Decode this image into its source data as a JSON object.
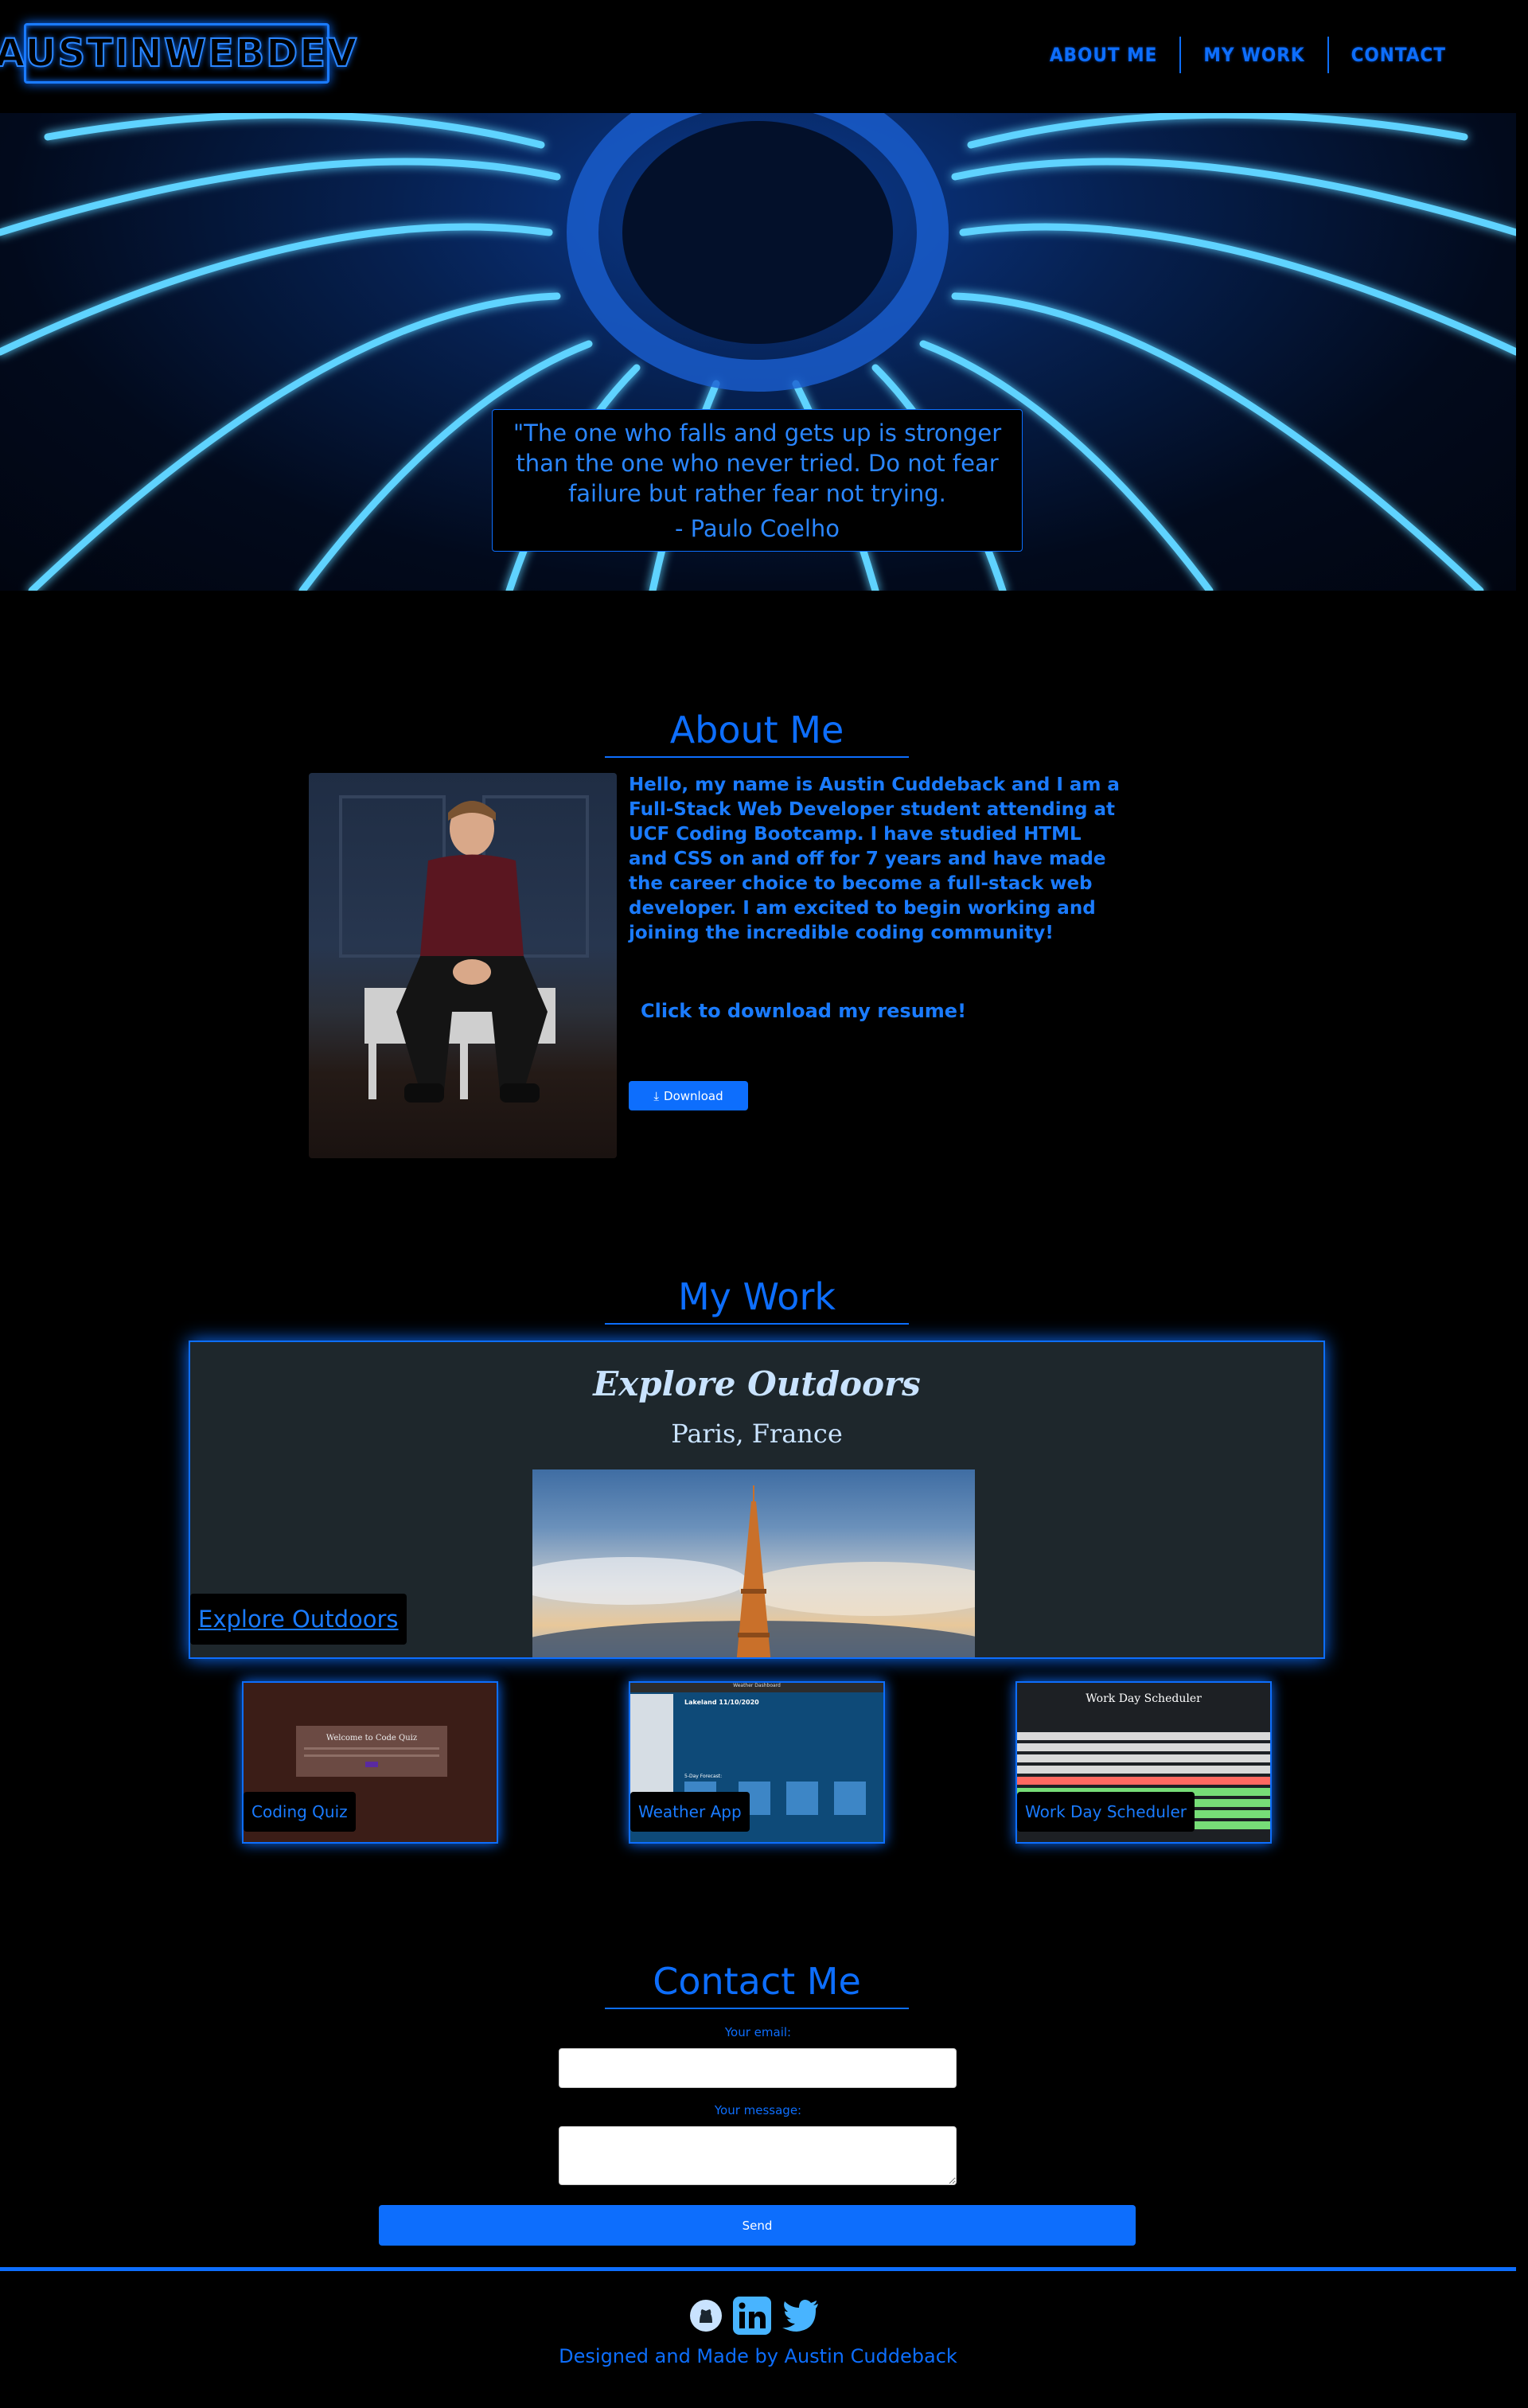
{
  "nav": {
    "logo": "AUSTINWEBDEV",
    "links": [
      "ABOUT ME",
      "MY WORK",
      "CONTACT"
    ]
  },
  "hero": {
    "quote": "\"The one who falls and gets up is stronger than the one who never tried. Do not fear failure but rather fear not trying.",
    "author": "- Paulo Coelho"
  },
  "about": {
    "title": "About Me",
    "bio": "Hello, my name is Austin Cuddeback and I am a Full-Stack Web Developer student attending at UCF Coding Bootcamp. I have studied HTML and CSS on and off for 7 years and have made the career choice to become a full-stack web developer. I am excited to begin working and joining the incredible coding community!",
    "resume_label": "Click to download my resume!",
    "download_label": "Download"
  },
  "work": {
    "title": "My Work",
    "featured": {
      "heading": "Explore Outdoors",
      "subheading": "Paris, France",
      "label": "Explore Outdoors"
    },
    "projects": [
      {
        "label": "Coding Quiz",
        "preview_title": "Welcome to Code Quiz"
      },
      {
        "label": "Weather App",
        "preview_title": "Weather Dashboard",
        "preview_city": "Lakeland 11/10/2020",
        "preview_forecast": "5-Day Forecast:"
      },
      {
        "label": "Work Day Scheduler",
        "preview_title": "Work Day Scheduler"
      }
    ]
  },
  "contact": {
    "title": "Contact Me",
    "email_label": "Your email:",
    "message_label": "Your message:",
    "send_label": "Send"
  },
  "footer": {
    "credit": "Designed and Made by Austin Cuddeback",
    "icons": [
      "github-icon",
      "linkedin-icon",
      "twitter-icon"
    ]
  },
  "colors": {
    "accent": "#0d6efd",
    "background": "#000000"
  }
}
